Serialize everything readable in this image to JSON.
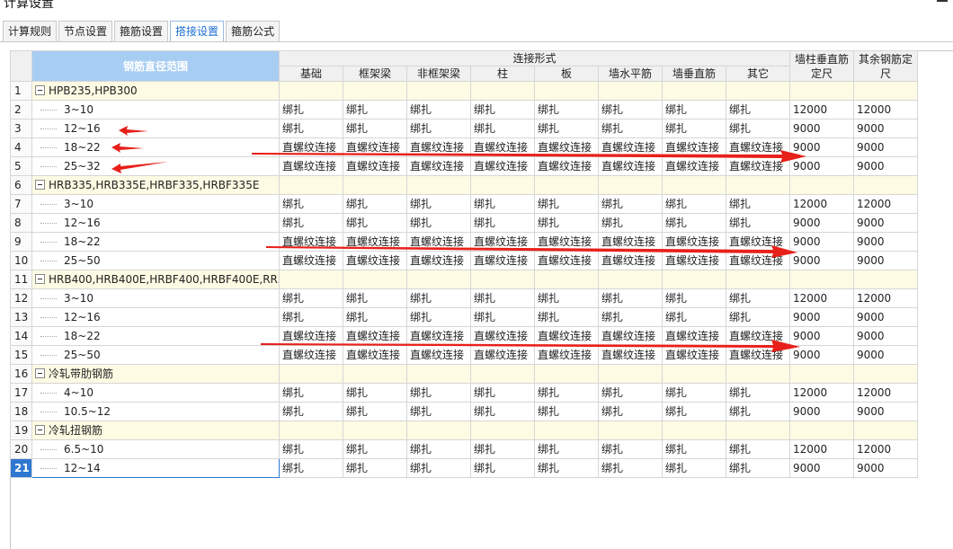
{
  "window": {
    "title": "计算设置"
  },
  "tabs": [
    {
      "label": "计算规则",
      "active": false
    },
    {
      "label": "节点设置",
      "active": false
    },
    {
      "label": "箍筋设置",
      "active": false
    },
    {
      "label": "搭接设置",
      "active": true
    },
    {
      "label": "箍筋公式",
      "active": false
    }
  ],
  "table": {
    "header_diameter": "钢筋直径范围",
    "header_connection": "连接形式",
    "connection_columns": [
      "基础",
      "框架梁",
      "非框架梁",
      "柱",
      "板",
      "墙水平筋",
      "墙垂直筋",
      "其它"
    ],
    "header_wall_column_length": "墙柱垂直筋定尺",
    "header_other_length": "其余钢筋定尺",
    "rows": [
      {
        "num": "1",
        "group": true,
        "name": "HPB235,HPB300"
      },
      {
        "num": "2",
        "name": "3~10",
        "values": [
          "绑扎",
          "绑扎",
          "绑扎",
          "绑扎",
          "绑扎",
          "绑扎",
          "绑扎",
          "绑扎"
        ],
        "len1": "12000",
        "len2": "12000"
      },
      {
        "num": "3",
        "name": "12~16",
        "values": [
          "绑扎",
          "绑扎",
          "绑扎",
          "绑扎",
          "绑扎",
          "绑扎",
          "绑扎",
          "绑扎"
        ],
        "len1": "9000",
        "len2": "9000"
      },
      {
        "num": "4",
        "name": "18~22",
        "values": [
          "直螺纹连接",
          "直螺纹连接",
          "直螺纹连接",
          "直螺纹连接",
          "直螺纹连接",
          "直螺纹连接",
          "直螺纹连接",
          "直螺纹连接"
        ],
        "len1": "9000",
        "len2": "9000"
      },
      {
        "num": "5",
        "name": "25~32",
        "values": [
          "直螺纹连接",
          "直螺纹连接",
          "直螺纹连接",
          "直螺纹连接",
          "直螺纹连接",
          "直螺纹连接",
          "直螺纹连接",
          "直螺纹连接"
        ],
        "len1": "9000",
        "len2": "9000"
      },
      {
        "num": "6",
        "group": true,
        "name": "HRB335,HRB335E,HRBF335,HRBF335E"
      },
      {
        "num": "7",
        "name": "3~10",
        "values": [
          "绑扎",
          "绑扎",
          "绑扎",
          "绑扎",
          "绑扎",
          "绑扎",
          "绑扎",
          "绑扎"
        ],
        "len1": "12000",
        "len2": "12000"
      },
      {
        "num": "8",
        "name": "12~16",
        "values": [
          "绑扎",
          "绑扎",
          "绑扎",
          "绑扎",
          "绑扎",
          "绑扎",
          "绑扎",
          "绑扎"
        ],
        "len1": "9000",
        "len2": "9000"
      },
      {
        "num": "9",
        "name": "18~22",
        "values": [
          "直螺纹连接",
          "直螺纹连接",
          "直螺纹连接",
          "直螺纹连接",
          "直螺纹连接",
          "直螺纹连接",
          "直螺纹连接",
          "直螺纹连接"
        ],
        "len1": "9000",
        "len2": "9000"
      },
      {
        "num": "10",
        "name": "25~50",
        "values": [
          "直螺纹连接",
          "直螺纹连接",
          "直螺纹连接",
          "直螺纹连接",
          "直螺纹连接",
          "直螺纹连接",
          "直螺纹连接",
          "直螺纹连接"
        ],
        "len1": "9000",
        "len2": "9000"
      },
      {
        "num": "11",
        "group": true,
        "name": "HRB400,HRB400E,HRBF400,HRBF400E,RR..."
      },
      {
        "num": "12",
        "name": "3~10",
        "values": [
          "绑扎",
          "绑扎",
          "绑扎",
          "绑扎",
          "绑扎",
          "绑扎",
          "绑扎",
          "绑扎"
        ],
        "len1": "12000",
        "len2": "12000"
      },
      {
        "num": "13",
        "name": "12~16",
        "values": [
          "绑扎",
          "绑扎",
          "绑扎",
          "绑扎",
          "绑扎",
          "绑扎",
          "绑扎",
          "绑扎"
        ],
        "len1": "9000",
        "len2": "9000"
      },
      {
        "num": "14",
        "name": "18~22",
        "values": [
          "直螺纹连接",
          "直螺纹连接",
          "直螺纹连接",
          "直螺纹连接",
          "直螺纹连接",
          "直螺纹连接",
          "直螺纹连接",
          "直螺纹连接"
        ],
        "len1": "9000",
        "len2": "9000"
      },
      {
        "num": "15",
        "name": "25~50",
        "values": [
          "直螺纹连接",
          "直螺纹连接",
          "直螺纹连接",
          "直螺纹连接",
          "直螺纹连接",
          "直螺纹连接",
          "直螺纹连接",
          "直螺纹连接"
        ],
        "len1": "9000",
        "len2": "9000"
      },
      {
        "num": "16",
        "group": true,
        "name": "冷轧带肋钢筋"
      },
      {
        "num": "17",
        "name": "4~10",
        "values": [
          "绑扎",
          "绑扎",
          "绑扎",
          "绑扎",
          "绑扎",
          "绑扎",
          "绑扎",
          "绑扎"
        ],
        "len1": "12000",
        "len2": "12000"
      },
      {
        "num": "18",
        "name": "10.5~12",
        "values": [
          "绑扎",
          "绑扎",
          "绑扎",
          "绑扎",
          "绑扎",
          "绑扎",
          "绑扎",
          "绑扎"
        ],
        "len1": "9000",
        "len2": "9000"
      },
      {
        "num": "19",
        "group": true,
        "name": "冷轧扭钢筋"
      },
      {
        "num": "20",
        "name": "6.5~10",
        "values": [
          "绑扎",
          "绑扎",
          "绑扎",
          "绑扎",
          "绑扎",
          "绑扎",
          "绑扎",
          "绑扎"
        ],
        "len1": "12000",
        "len2": "12000"
      },
      {
        "num": "21",
        "name": "12~14",
        "values": [
          "绑扎",
          "绑扎",
          "绑扎",
          "绑扎",
          "绑扎",
          "绑扎",
          "绑扎",
          "绑扎"
        ],
        "len1": "9000",
        "len2": "9000",
        "selected": true
      }
    ]
  },
  "annotations": {
    "arrow_color": "#e8201a"
  }
}
